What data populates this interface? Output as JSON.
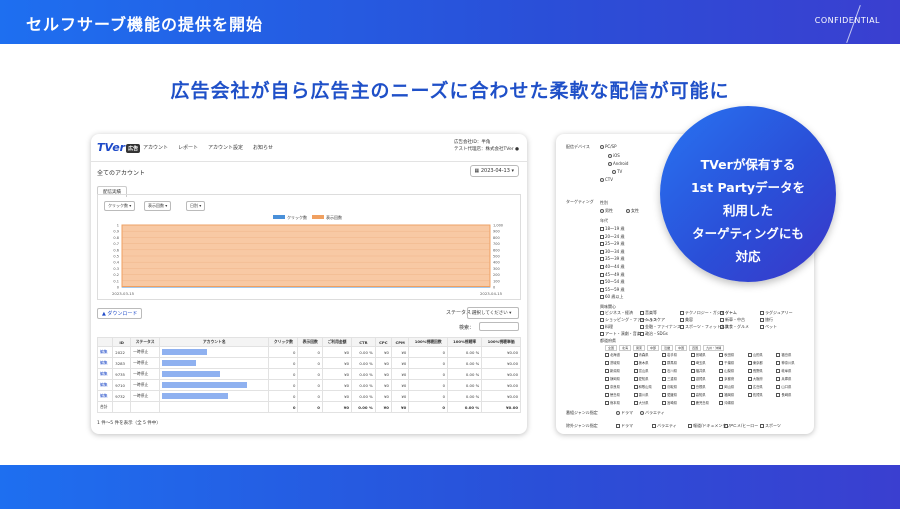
{
  "header": {
    "title": "セルフサーブ機能の提供を開始",
    "confidential": "CONFIDENTIAL"
  },
  "headline": "広告会社が自ら広告主のニーズに合わせた柔軟な配信が可能に",
  "callout": {
    "lines": [
      "TVerが保有する",
      "1st Partyデータを",
      "利用した",
      "ターゲティングにも",
      "対応"
    ]
  },
  "admin": {
    "logo": "TVer",
    "logo_badge": "広告",
    "nav": [
      "アカウント",
      "レポート",
      "アカウント設定",
      "お知らせ"
    ],
    "account_info": [
      "広告会社ID：半角",
      "テスト代理店：株式会社TVer ●"
    ],
    "page_title": "全てのアカウント",
    "date": "2023-04-13 ▾",
    "tab": "配信実績",
    "selects": [
      "クリック数 ▾",
      "表示回数 ▾",
      "日別 ▾"
    ],
    "legend": [
      "クリック数",
      "表示回数"
    ],
    "download": "▲ ダウンロード",
    "status_label": "ステータス：",
    "status_value": "選択してください ▾",
    "search_label": "検索：",
    "table": {
      "headers": [
        "ID",
        "ステータス",
        "アカウント名",
        "クリック数",
        "表示回数",
        "ご利用金額",
        "CTR",
        "CPC",
        "CPM",
        "100%視聴回数",
        "100%視聴率",
        "100%視聴単価"
      ],
      "rows": [
        {
          "action": "編集",
          "id": "2022",
          "status": "一時停止",
          "bar": 0.45,
          "clicks": "0",
          "imps": "0",
          "cost": "¥0",
          "ctr": "0.00 %",
          "cpc": "¥0",
          "cpm": "¥0",
          "views": "0",
          "vrate": "0.00 %",
          "vcost": "¥0.00"
        },
        {
          "action": "編集",
          "id": "3283",
          "status": "一時停止",
          "bar": 0.34,
          "clicks": "0",
          "imps": "0",
          "cost": "¥0",
          "ctr": "0.00 %",
          "cpc": "¥0",
          "cpm": "¥0",
          "views": "0",
          "vrate": "0.00 %",
          "vcost": "¥0.00"
        },
        {
          "action": "編集",
          "id": "9735",
          "status": "一時停止",
          "bar": 0.58,
          "clicks": "0",
          "imps": "0",
          "cost": "¥0",
          "ctr": "0.00 %",
          "cpc": "¥0",
          "cpm": "¥0",
          "views": "0",
          "vrate": "0.00 %",
          "vcost": "¥0.00"
        },
        {
          "action": "編集",
          "id": "9710",
          "status": "一時停止",
          "bar": 0.85,
          "clicks": "0",
          "imps": "0",
          "cost": "¥0",
          "ctr": "0.00 %",
          "cpc": "¥0",
          "cpm": "¥0",
          "views": "0",
          "vrate": "0.00 %",
          "vcost": "¥0.00"
        },
        {
          "action": "編集",
          "id": "9732",
          "status": "一時停止",
          "bar": 0.66,
          "clicks": "0",
          "imps": "0",
          "cost": "¥0",
          "ctr": "0.00 %",
          "cpc": "¥0",
          "cpm": "¥0",
          "views": "0",
          "vrate": "0.00 %",
          "vcost": "¥0.00"
        }
      ],
      "total": {
        "label": "合計",
        "clicks": "0",
        "imps": "0",
        "cost": "¥0",
        "ctr": "0.00 %",
        "cpc": "¥0",
        "cpm": "¥0",
        "views": "0",
        "vrate": "0.00 %",
        "vcost": "¥0.00"
      }
    },
    "pager": "1 件～5 件を表示（全 5 件中）"
  },
  "chart_data": {
    "type": "line",
    "x": [
      "2023-03-15",
      "2023-04-15"
    ],
    "xlabel": "",
    "ylabel": "",
    "yticks_left": [
      "1",
      "0.9",
      "0.8",
      "0.7",
      "0.6",
      "0.5",
      "0.4",
      "0.3",
      "0.2",
      "0.1",
      "0"
    ],
    "yticks_right": [
      "1,000",
      "900",
      "800",
      "700",
      "600",
      "500",
      "400",
      "300",
      "200",
      "100",
      "0"
    ],
    "series": [
      {
        "name": "クリック数",
        "values": [
          0,
          0
        ],
        "color": "#4a90d9"
      },
      {
        "name": "表示回数",
        "values": [
          0,
          0
        ],
        "color": "#f0a060"
      }
    ]
  },
  "targeting": {
    "device_label": "配信デバイス",
    "devices": [
      "PC/SP",
      "iOS",
      "Android",
      "TV",
      "CTV"
    ],
    "targeting_label": "ターゲティング",
    "gender_label": "性別",
    "genders": [
      "男性",
      "女性"
    ],
    "age_label": "年代",
    "ages": [
      "18～19 歳",
      "20～24 歳",
      "25～29 歳",
      "30～34 歳",
      "35～39 歳",
      "40～44 歳",
      "45～49 歳",
      "50～54 歳",
      "55～59 歳",
      "60 歳以上"
    ],
    "interest_label": "興味関心",
    "interests": [
      "ビジネス・経済",
      "音楽等",
      "テクノロジー・ガジェット",
      "ゲーム",
      "ラグジュアリー",
      "ショッピング・ファッション",
      "ヘルスケア",
      "美容",
      "新車・中古",
      "旅行",
      "料理",
      "金融・ファイナンス",
      "スポーツ・フィットネス",
      "飲食・グルメ",
      "ペット",
      "アート・演劇・音楽",
      "政治・SDGs"
    ],
    "region_label": "都道府県",
    "region_tabs": [
      "全国",
      "北海",
      "関東",
      "中部",
      "近畿",
      "中国",
      "四国",
      "九州・沖縄"
    ],
    "prefectures": [
      "北海道",
      "青森県",
      "岩手県",
      "宮城県",
      "秋田県",
      "山形県",
      "福島県",
      "茨城県",
      "栃木県",
      "群馬県",
      "埼玉県",
      "千葉県",
      "東京都",
      "神奈川県",
      "新潟県",
      "富山県",
      "石川県",
      "福井県",
      "山梨県",
      "長野県",
      "岐阜県",
      "静岡県",
      "愛知県",
      "三重県",
      "滋賀県",
      "京都府",
      "大阪府",
      "兵庫県",
      "奈良県",
      "和歌山県",
      "鳥取県",
      "島根県",
      "岡山県",
      "広島県",
      "山口県",
      "徳島県",
      "香川県",
      "愛媛県",
      "高知県",
      "福岡県",
      "佐賀県",
      "長崎県",
      "熊本県",
      "大分県",
      "宮崎県",
      "鹿児島県",
      "沖縄県"
    ],
    "genre_label": "番組ジャンル指定",
    "genre_opts": [
      "ドラマ",
      "バラエティ"
    ],
    "genre_exclude_label": "除外ジャンル指定",
    "genre_exclude_opts": [
      "ドラマ",
      "バラエティ",
      "報道/ドキュメンタリー",
      "アニメ/ヒーロー",
      "スポーツ"
    ]
  }
}
